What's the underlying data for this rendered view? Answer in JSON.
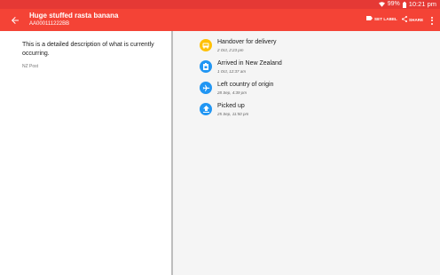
{
  "status_bar": {
    "battery": "99%",
    "time": "10:21 pm"
  },
  "app_bar": {
    "title": "Huge stuffed rasta banana",
    "subtitle": "AA000111222BB",
    "actions": {
      "set_label": "SET LABEL",
      "share": "SHARE"
    }
  },
  "detail": {
    "description": "This is a detailed description of what is currently occurring.",
    "carrier": "NZ Post"
  },
  "events": [
    {
      "title": "Handover for delivery",
      "time": "2 Oct, 2:23 pm",
      "icon": "delivery-truck-icon",
      "color": "#ffc107"
    },
    {
      "title": "Arrived in New Zealand",
      "time": "1 Oct, 12:37 am",
      "icon": "package-icon",
      "color": "#2196f3"
    },
    {
      "title": "Left country of origin",
      "time": "28 Sep, 4:39 pm",
      "icon": "airplane-icon",
      "color": "#2196f3"
    },
    {
      "title": "Picked up",
      "time": "25 Sep, 11:50 pm",
      "icon": "upload-icon",
      "color": "#2196f3"
    }
  ],
  "colors": {
    "primary": "#f44336",
    "primary_dark": "#e53935",
    "event_amber": "#ffc107",
    "event_blue": "#2196f3"
  }
}
